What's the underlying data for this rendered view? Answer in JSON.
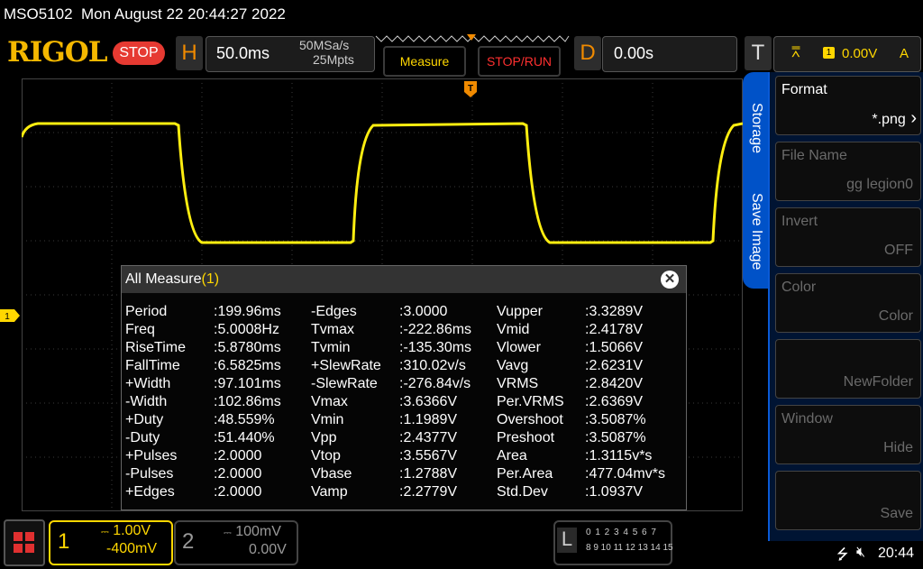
{
  "status": {
    "model": "MSO5102",
    "datetime": "Mon August 22 20:44:27 2022"
  },
  "header": {
    "logo": "RIGOL",
    "run_state": "STOP",
    "horizontal": {
      "key": "H",
      "timebase": "50.0ms",
      "sample_rate": "50MSa/s",
      "memory_depth": "25Mpts"
    },
    "measure_label": "Measure",
    "stoprun_label": "STOP/RUN",
    "delay": {
      "key": "D",
      "value": "0.00s"
    },
    "trigger": {
      "key": "T",
      "channel": "1",
      "level": "0.00V",
      "mode": "A"
    }
  },
  "markers": {
    "ch1": "1",
    "trigger": "T"
  },
  "measure": {
    "title": "All Measure",
    "title_channel": "(1)",
    "close_label": "✕",
    "col1": [
      {
        "name": "Period",
        "value": ":199.96ms"
      },
      {
        "name": "Freq",
        "value": ":5.0008Hz"
      },
      {
        "name": "RiseTime",
        "value": ":5.8780ms"
      },
      {
        "name": "FallTime",
        "value": ":6.5825ms"
      },
      {
        "name": "+Width",
        "value": ":97.101ms"
      },
      {
        "name": "-Width",
        "value": ":102.86ms"
      },
      {
        "name": "+Duty",
        "value": ":48.559%"
      },
      {
        "name": "-Duty",
        "value": ":51.440%"
      },
      {
        "name": "+Pulses",
        "value": ":2.0000"
      },
      {
        "name": "-Pulses",
        "value": ":2.0000"
      },
      {
        "name": "+Edges",
        "value": ":2.0000"
      }
    ],
    "col2": [
      {
        "name": "-Edges",
        "value": ":3.0000"
      },
      {
        "name": "Tvmax",
        "value": ":-222.86ms"
      },
      {
        "name": "Tvmin",
        "value": ":-135.30ms"
      },
      {
        "name": "+SlewRate",
        "value": ":310.02v/s"
      },
      {
        "name": "-SlewRate",
        "value": ":-276.84v/s"
      },
      {
        "name": "Vmax",
        "value": ":3.6366V"
      },
      {
        "name": "Vmin",
        "value": ":1.1989V"
      },
      {
        "name": "Vpp",
        "value": ":2.4377V"
      },
      {
        "name": "Vtop",
        "value": ":3.5567V"
      },
      {
        "name": "Vbase",
        "value": ":1.2788V"
      },
      {
        "name": "Vamp",
        "value": ":2.2779V"
      }
    ],
    "col3": [
      {
        "name": "Vupper",
        "value": ":3.3289V"
      },
      {
        "name": "Vmid",
        "value": ":2.4178V"
      },
      {
        "name": "Vlower",
        "value": ":1.5066V"
      },
      {
        "name": "Vavg",
        "value": ":2.6231V"
      },
      {
        "name": "VRMS",
        "value": ":2.8420V"
      },
      {
        "name": "Per.VRMS",
        "value": ":2.6369V"
      },
      {
        "name": "Overshoot",
        "value": ":3.5087%"
      },
      {
        "name": "Preshoot",
        "value": ":3.5087%"
      },
      {
        "name": "Area",
        "value": ":1.3115v*s"
      },
      {
        "name": "Per.Area",
        "value": ":477.04mv*s"
      },
      {
        "name": "Std.Dev",
        "value": ":1.0937V"
      }
    ]
  },
  "menu": {
    "tabs": [
      "Storage",
      "Save Image"
    ],
    "items": [
      {
        "label": "Format",
        "value": "*.png",
        "enabled": true,
        "arrow": true
      },
      {
        "label": "File Name",
        "value": "gg legion0",
        "enabled": false
      },
      {
        "label": "Invert",
        "value": "OFF",
        "enabled": false
      },
      {
        "label": "Color",
        "value": "Color",
        "enabled": false
      },
      {
        "label": "",
        "value": "NewFolder",
        "enabled": false
      },
      {
        "label": "Window",
        "value": "Hide",
        "enabled": false
      },
      {
        "label": "",
        "value": "Save",
        "enabled": false
      }
    ]
  },
  "bottom": {
    "ch1": {
      "num": "1",
      "scale": "1.00V",
      "offset": "-400mV"
    },
    "ch2": {
      "num": "2",
      "scale": "100mV",
      "offset": "0.00V"
    },
    "la": {
      "key": "L",
      "row1": "0 1 2 3  4 5 6 7",
      "row2": "8 9 10 11 12 13 14 15"
    },
    "time": "20:44",
    "usb_icon": "usb-icon",
    "speaker_icon": "speaker-muted-icon"
  },
  "colors": {
    "ch1": "#ffd700",
    "accent": "#f08a00",
    "menu": "#0052c8"
  },
  "waveform": {
    "channel": "1",
    "shape": "square",
    "volts_per_div": 1.0,
    "period_ms": 199.96,
    "high_v": 3.5567,
    "low_v": 1.2788
  }
}
